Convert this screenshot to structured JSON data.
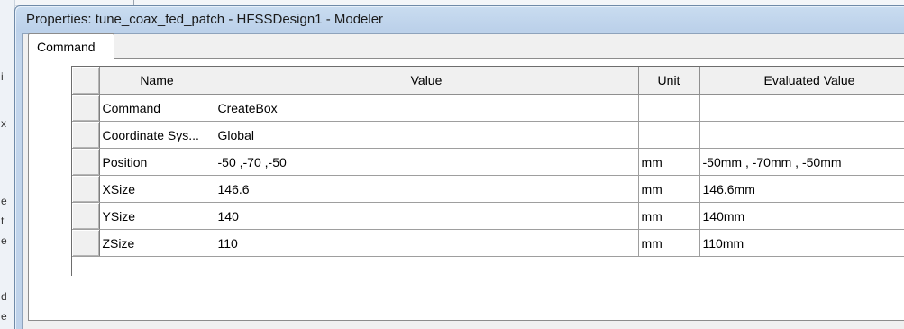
{
  "background_window": {
    "left_fragments": [
      "i",
      "x",
      "e",
      "t",
      "e",
      "d",
      "e"
    ]
  },
  "dialog": {
    "title": "Properties: tune_coax_fed_patch - HFSSDesign1 - Modeler",
    "tabs": [
      {
        "label": "Command",
        "selected": true
      }
    ]
  },
  "grid": {
    "columns": [
      "",
      "Name",
      "Value",
      "Unit",
      "Evaluated Value"
    ],
    "rows": [
      {
        "name": "Command",
        "value": "CreateBox",
        "unit": "",
        "evaluated": ""
      },
      {
        "name": "Coordinate Sys...",
        "value": "Global",
        "unit": "",
        "evaluated": ""
      },
      {
        "name": "Position",
        "value": "-50 ,-70 ,-50",
        "unit": "mm",
        "evaluated": "-50mm , -70mm , -50mm"
      },
      {
        "name": "XSize",
        "value": "146.6",
        "unit": "mm",
        "evaluated": "146.6mm"
      },
      {
        "name": "YSize",
        "value": "140",
        "unit": "mm",
        "evaluated": "140mm"
      },
      {
        "name": "ZSize",
        "value": "110",
        "unit": "mm",
        "evaluated": "110mm"
      }
    ]
  },
  "colors": {
    "title_bar": "#c3d6ec",
    "header_bg": "#f0f0f0",
    "grid_line": "#9e9e9e"
  }
}
